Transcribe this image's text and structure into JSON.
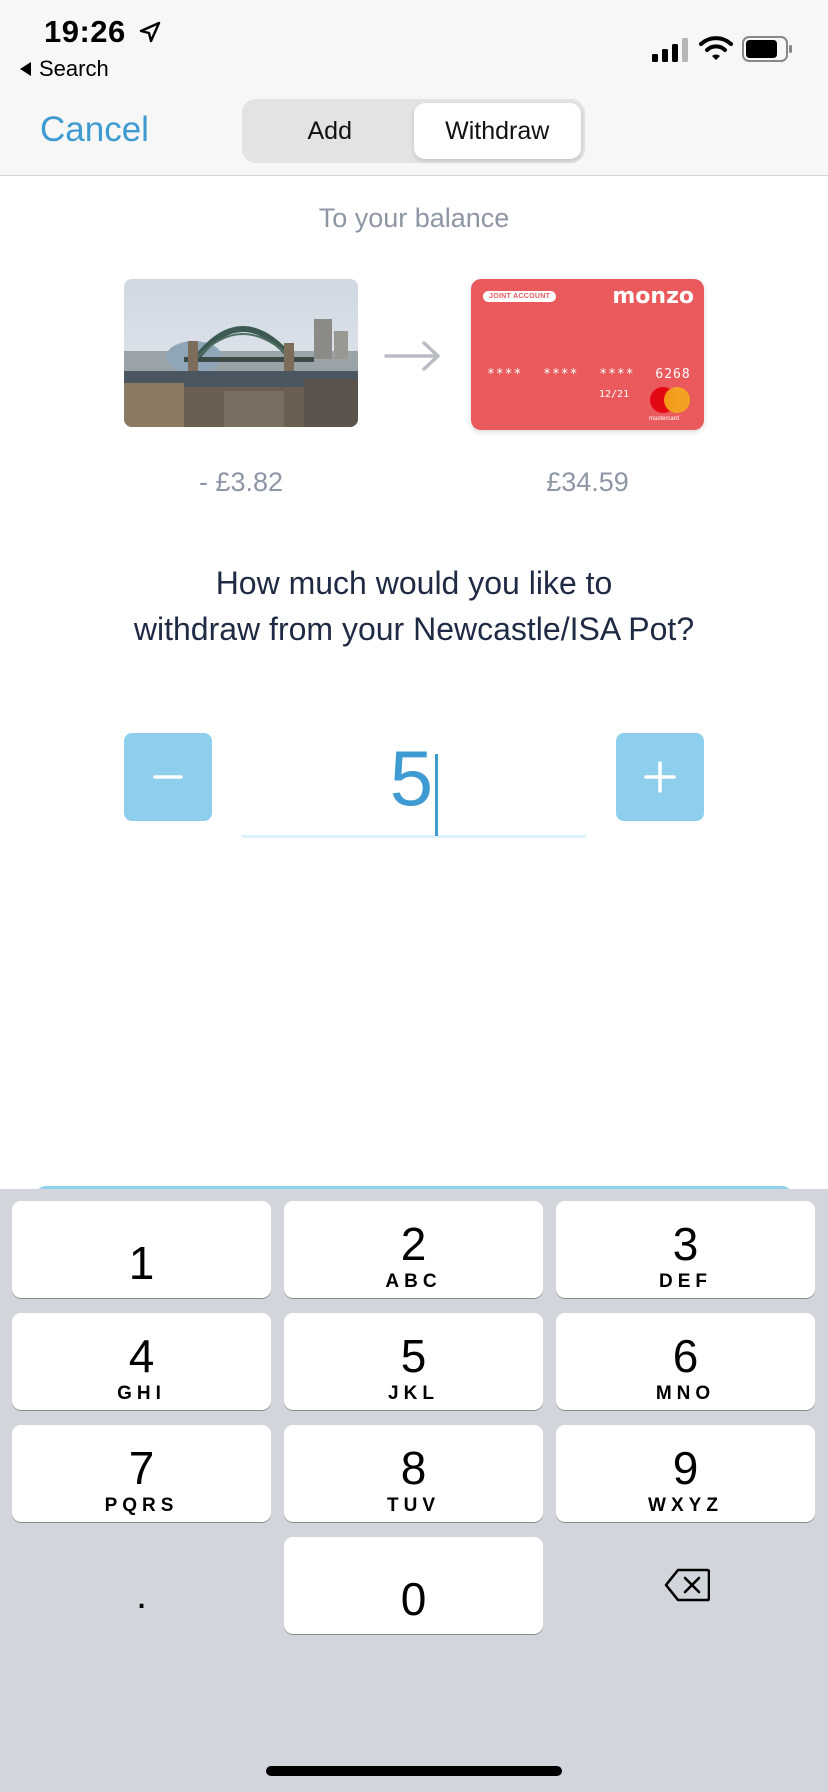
{
  "status_bar": {
    "time": "19:26",
    "back_label": "Search",
    "icons": [
      "location-arrow-icon",
      "signal-icon",
      "wifi-icon",
      "battery-icon"
    ]
  },
  "nav": {
    "cancel_label": "Cancel",
    "segments": [
      {
        "label": "Add",
        "active": false
      },
      {
        "label": "Withdraw",
        "active": true
      }
    ]
  },
  "transfer": {
    "subtitle": "To your balance",
    "from_amount": "- £3.82",
    "to_amount": "£34.59",
    "card": {
      "badge": "JOINT ACCOUNT",
      "brand": "monzo",
      "number": "**** **** **** 6268",
      "expiry": "12/21",
      "network": "mastercard",
      "color": "#ea5a5c"
    }
  },
  "question": {
    "line1": "How much would you like to",
    "line2": "withdraw from your Newcastle/ISA Pot?"
  },
  "amount": {
    "value": "5"
  },
  "keyboard": {
    "keys": [
      {
        "num": "1",
        "letters": ""
      },
      {
        "num": "2",
        "letters": "ABC"
      },
      {
        "num": "3",
        "letters": "DEF"
      },
      {
        "num": "4",
        "letters": "GHI"
      },
      {
        "num": "5",
        "letters": "JKL"
      },
      {
        "num": "6",
        "letters": "MNO"
      },
      {
        "num": "7",
        "letters": "PQRS"
      },
      {
        "num": "8",
        "letters": "TUV"
      },
      {
        "num": "9",
        "letters": "WXYZ"
      },
      {
        "num": "0",
        "letters": ""
      }
    ],
    "decimal": "."
  },
  "colors": {
    "accent": "#3d9bd2",
    "stepper": "#8ecfee",
    "keyboard_bg": "#d2d5db"
  }
}
